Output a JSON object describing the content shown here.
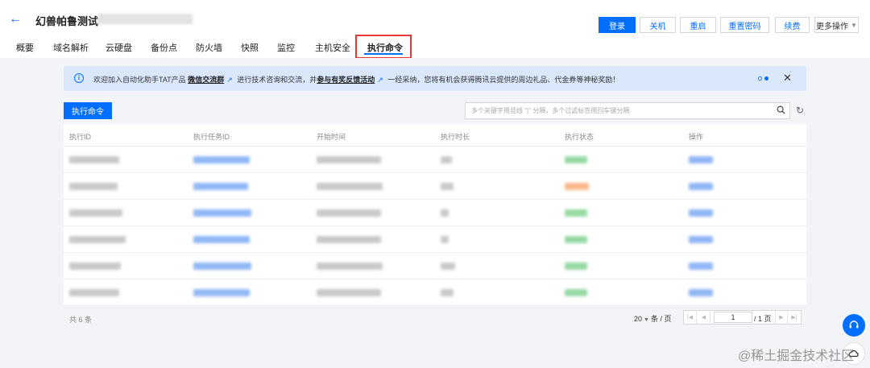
{
  "header": {
    "back_icon": "arrow-left-icon",
    "title": "幻兽帕鲁测试",
    "buttons": {
      "login": "登录",
      "shutdown": "关机",
      "restart": "重启",
      "reset_password": "重置密码",
      "renew": "续费",
      "more": "更多操作"
    }
  },
  "tabs": [
    "概要",
    "域名解析",
    "云硬盘",
    "备份点",
    "防火墙",
    "快照",
    "监控",
    "主机安全",
    "执行命令"
  ],
  "active_tab": "执行命令",
  "notice": {
    "icon": "info-icon",
    "text_1": "欢迎加入自动化助手TAT产品",
    "link_1": "微信交流群",
    "text_2": "进行技术咨询和交流，并",
    "link_2": "参与有奖反馈活动",
    "text_3": "一经采纳，您将有机会获得腾讯云提供的周边礼品、代金券等神秘奖励！",
    "close": "✕"
  },
  "toolbar": {
    "exec_button": "执行命令",
    "search_placeholder": "多个关键字用竖线 \"|\" 分隔，多个过滤标签用回车键分隔"
  },
  "table": {
    "columns": [
      "执行ID",
      "执行任务ID",
      "开始时间",
      "执行时长",
      "执行状态",
      "操作"
    ],
    "row_status_colors": [
      "green",
      "orange",
      "green",
      "green",
      "green",
      "green"
    ]
  },
  "footer": {
    "total": "共 6 条",
    "page_size": "20",
    "page_size_suffix": "条 / 页",
    "current_page": "1",
    "total_pages": "/ 1 页"
  },
  "watermark": "@稀土掘金技术社区",
  "colors": {
    "accent": "#006eff",
    "highlight": "#e53935",
    "notice_bg": "#dbe8fc"
  }
}
